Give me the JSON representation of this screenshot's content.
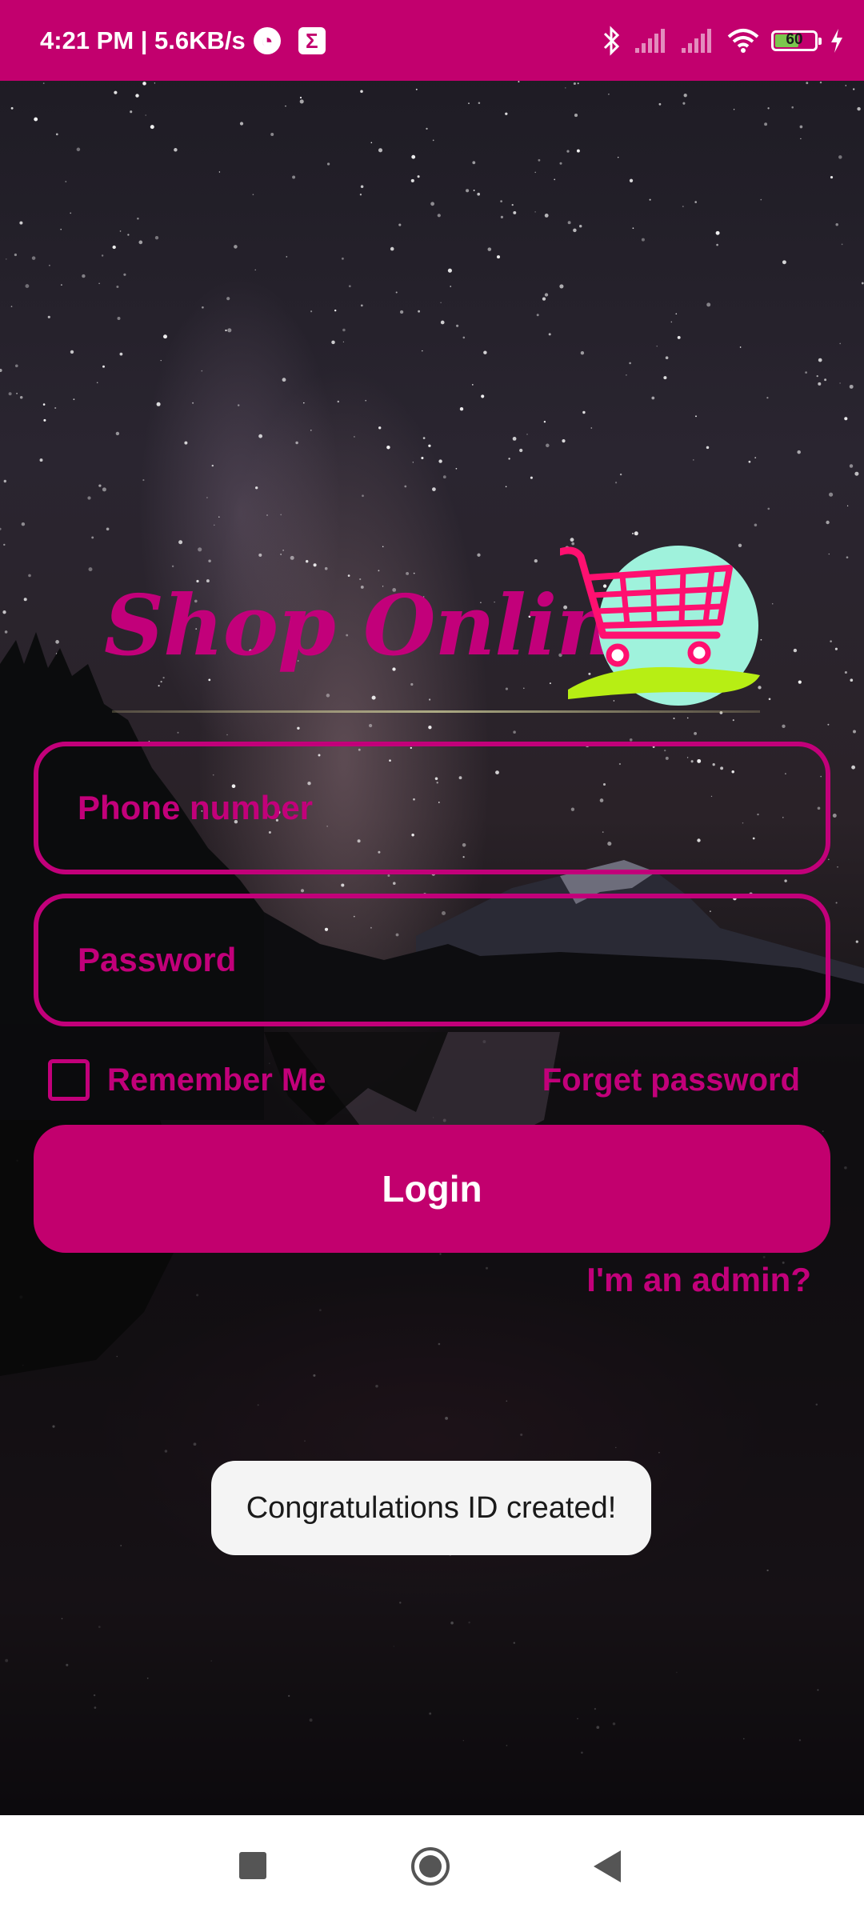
{
  "status_bar": {
    "time_speed": "4:21 PM | 5.6KB/s",
    "battery_level": "60",
    "battery_fraction": 0.6,
    "icons": [
      "data-saver-icon",
      "sigma-icon",
      "bluetooth-icon",
      "signal-icon",
      "signal-icon",
      "wifi-icon",
      "battery-icon",
      "charging-icon"
    ],
    "color": "#c2006e"
  },
  "logo": {
    "text": "Shop Online",
    "icon": "shopping-cart-icon",
    "colors": {
      "text": "#c2007a",
      "circle": "#9ff2dc",
      "cart": "#ff1070",
      "hill": "#b7ee14"
    }
  },
  "form": {
    "phone_placeholder": "Phone number",
    "password_placeholder": "Password",
    "remember_label": "Remember Me",
    "remember_checked": false,
    "forget_label": "Forget password",
    "login_label": "Login",
    "admin_label": "I'm an admin?"
  },
  "toast": {
    "message": "Congratulations ID created!"
  },
  "nav_bar": {
    "icons": [
      "recent-apps-icon",
      "home-icon",
      "back-icon"
    ]
  },
  "theme": {
    "accent": "#c2007a",
    "button": "#c2006e",
    "toast_bg": "#f4f4f4"
  }
}
